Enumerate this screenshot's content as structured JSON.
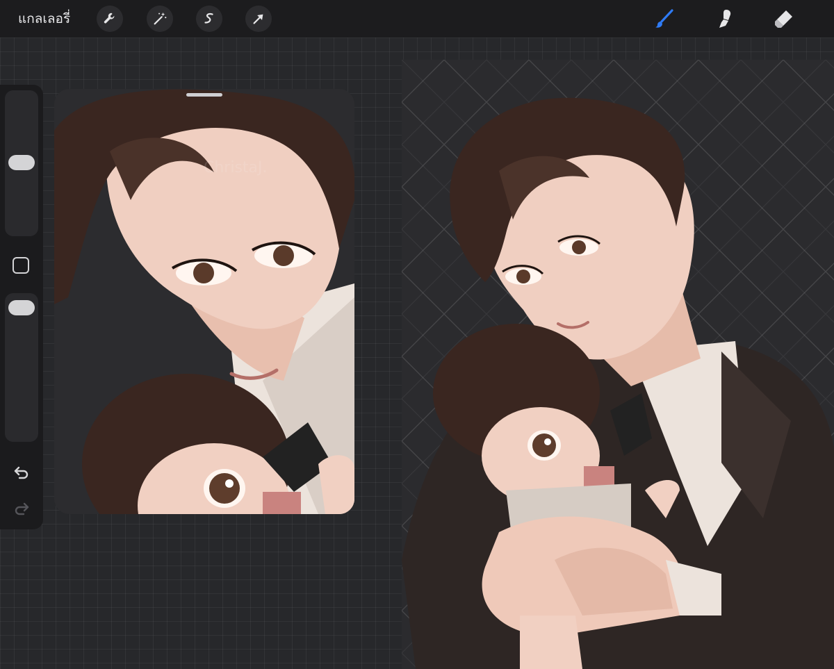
{
  "topbar": {
    "gallery_label": "แกลเลอรี่",
    "left_tools": [
      "wrench-icon",
      "magic-wand-icon",
      "selection-icon",
      "transform-arrow-icon"
    ],
    "right_tools": [
      "brush-icon",
      "smudge-icon",
      "eraser-icon"
    ],
    "active_tool": "brush-icon",
    "accent_color": "#2f7bf5"
  },
  "sidebar": {
    "size_slider": 0.5,
    "opacity_slider": 0.95
  },
  "watermark": "ChristaJ.",
  "colors": {
    "hair": "#3a2620",
    "skin": "#ecc7b8",
    "suit": "#2e2624",
    "shirt": "#ece3dc",
    "bow": "#222"
  }
}
